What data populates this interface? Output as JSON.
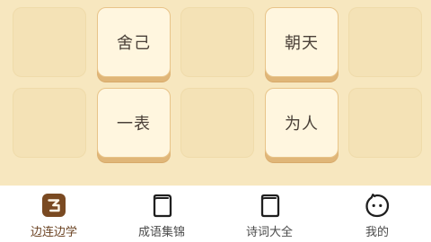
{
  "board": {
    "tiles": {
      "r1c2": "舍己",
      "r1c4": "朝天",
      "r2c2": "一表",
      "r2c4": "为人"
    }
  },
  "tabbar": {
    "tabs": [
      {
        "label": "边连边学",
        "icon": "lian-badge-icon",
        "active": true
      },
      {
        "label": "成语集锦",
        "icon": "book-icon",
        "active": false
      },
      {
        "label": "诗词大全",
        "icon": "book-icon",
        "active": false
      },
      {
        "label": "我的",
        "icon": "face-icon",
        "active": false
      }
    ]
  },
  "colors": {
    "board_bg": "#f7e7bf",
    "tile_empty": "#f4e2b6",
    "tile_filled": "#fff6df",
    "tile_shadow": "#e0b678",
    "accent_brown": "#7a4a22"
  }
}
